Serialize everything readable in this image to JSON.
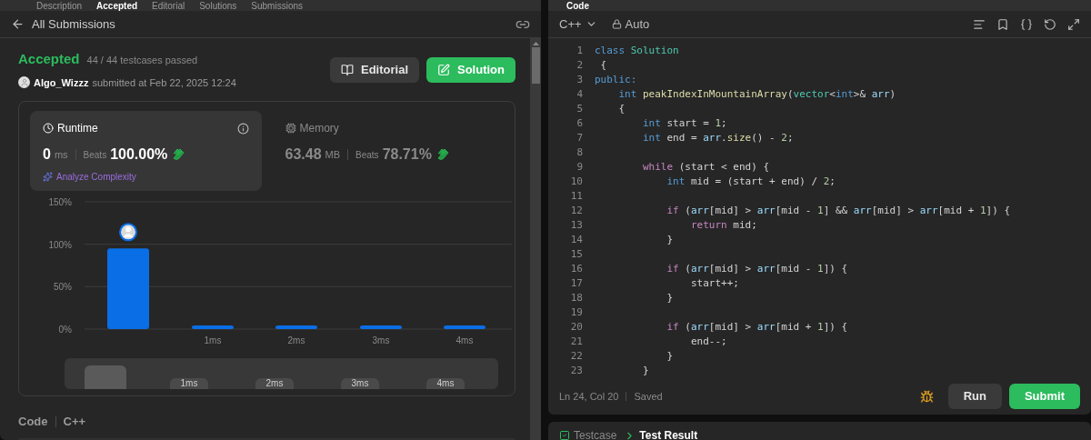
{
  "top_tabs": [
    {
      "label": "Description",
      "selected": false
    },
    {
      "label": "Accepted",
      "selected": true
    },
    {
      "label": "Editorial",
      "selected": false
    },
    {
      "label": "Solutions",
      "selected": false
    },
    {
      "label": "Submissions",
      "selected": false
    }
  ],
  "code_tab": {
    "label": "Code"
  },
  "back_link": "All Submissions",
  "result": {
    "status": "Accepted",
    "testcases": "44 / 44 testcases passed",
    "user": "Algo_Wizzz",
    "submitted": "submitted at Feb 22, 2025 12:24"
  },
  "actions": [
    {
      "label": "Editorial",
      "kind": "secondary"
    },
    {
      "label": "Solution",
      "kind": "primary"
    }
  ],
  "stats": [
    {
      "title": "Runtime",
      "selected": true,
      "value": "0",
      "unit": "ms",
      "beats_label": "Beats",
      "beats": "100.00%"
    },
    {
      "title": "Memory",
      "selected": false,
      "value": "63.48",
      "unit": "MB",
      "beats_label": "Beats",
      "beats": "78.71%"
    }
  ],
  "analyze": "Analyze Complexity",
  "chart_data": {
    "type": "bar",
    "categories": [
      null,
      "1ms",
      "2ms",
      "3ms",
      "4ms"
    ],
    "values": [
      95,
      3,
      3,
      3,
      3
    ],
    "ylim": [
      0,
      150
    ],
    "yticks": [
      {
        "value": 0,
        "label": "0%"
      },
      {
        "value": 50,
        "label": "50%"
      },
      {
        "value": 100,
        "label": "100%"
      },
      {
        "value": 150,
        "label": "150%"
      }
    ]
  },
  "brush_labels": [
    "1ms",
    "2ms",
    "3ms",
    "4ms"
  ],
  "code_section": {
    "title": "Code",
    "language": "C++"
  },
  "editor": {
    "language": "C++",
    "mode": "Auto",
    "status": "Ln 24, Col 20",
    "saved": "Saved",
    "lines": [
      {
        "n": "1",
        "tokens": [
          {
            "kind": "kw",
            "t": "class "
          },
          {
            "kind": "type",
            "t": "Solution"
          }
        ]
      },
      {
        "n": "2",
        "tokens": [
          {
            "kind": "plain",
            "t": " {"
          }
        ]
      },
      {
        "n": "3",
        "tokens": [
          {
            "kind": "kw",
            "t": "public:"
          }
        ]
      },
      {
        "n": "4",
        "tokens": [
          {
            "kind": "kw",
            "t": "    int "
          },
          {
            "kind": "fn",
            "t": "peakIndexInMountainArray"
          },
          {
            "kind": "plain",
            "t": "("
          },
          {
            "kind": "type",
            "t": "vector"
          },
          {
            "kind": "plain",
            "t": "<"
          },
          {
            "kind": "kw",
            "t": "int"
          },
          {
            "kind": "plain",
            "t": ">& "
          },
          {
            "kind": "var",
            "t": "arr"
          },
          {
            "kind": "plain",
            "t": ")"
          }
        ]
      },
      {
        "n": "5",
        "tokens": [
          {
            "kind": "plain",
            "t": "    {"
          }
        ]
      },
      {
        "n": "6",
        "tokens": [
          {
            "kind": "kw",
            "t": "        int "
          },
          {
            "kind": "plain",
            "t": "start = "
          },
          {
            "kind": "num",
            "t": "1"
          },
          {
            "kind": "plain",
            "t": ";"
          }
        ]
      },
      {
        "n": "7",
        "tokens": [
          {
            "kind": "kw",
            "t": "        int "
          },
          {
            "kind": "plain",
            "t": "end = "
          },
          {
            "kind": "var",
            "t": "arr"
          },
          {
            "kind": "plain",
            "t": "."
          },
          {
            "kind": "fn",
            "t": "size"
          },
          {
            "kind": "plain",
            "t": "() - "
          },
          {
            "kind": "num",
            "t": "2"
          },
          {
            "kind": "plain",
            "t": ";"
          }
        ]
      },
      {
        "n": "8"
      },
      {
        "n": "9",
        "tokens": [
          {
            "kind": "ctl",
            "t": "        while"
          },
          {
            "kind": "plain",
            "t": " (start < end) {"
          }
        ]
      },
      {
        "n": "10",
        "tokens": [
          {
            "kind": "kw",
            "t": "            int "
          },
          {
            "kind": "plain",
            "t": "mid = (start + end) / "
          },
          {
            "kind": "num",
            "t": "2"
          },
          {
            "kind": "plain",
            "t": ";"
          }
        ]
      },
      {
        "n": "11"
      },
      {
        "n": "12",
        "tokens": [
          {
            "kind": "ctl",
            "t": "            if"
          },
          {
            "kind": "plain",
            "t": " ("
          },
          {
            "kind": "var",
            "t": "arr"
          },
          {
            "kind": "plain",
            "t": "[mid] > "
          },
          {
            "kind": "var",
            "t": "arr"
          },
          {
            "kind": "plain",
            "t": "[mid - "
          },
          {
            "kind": "num",
            "t": "1"
          },
          {
            "kind": "plain",
            "t": "] && "
          },
          {
            "kind": "var",
            "t": "arr"
          },
          {
            "kind": "plain",
            "t": "[mid] > "
          },
          {
            "kind": "var",
            "t": "arr"
          },
          {
            "kind": "plain",
            "t": "[mid + "
          },
          {
            "kind": "num",
            "t": "1"
          },
          {
            "kind": "plain",
            "t": "]) {"
          }
        ]
      },
      {
        "n": "13",
        "tokens": [
          {
            "kind": "ctl",
            "t": "                return"
          },
          {
            "kind": "plain",
            "t": " mid;"
          }
        ]
      },
      {
        "n": "14",
        "tokens": [
          {
            "kind": "plain",
            "t": "            }"
          }
        ]
      },
      {
        "n": "15"
      },
      {
        "n": "16",
        "tokens": [
          {
            "kind": "ctl",
            "t": "            if"
          },
          {
            "kind": "plain",
            "t": " ("
          },
          {
            "kind": "var",
            "t": "arr"
          },
          {
            "kind": "plain",
            "t": "[mid] > "
          },
          {
            "kind": "var",
            "t": "arr"
          },
          {
            "kind": "plain",
            "t": "[mid - "
          },
          {
            "kind": "num",
            "t": "1"
          },
          {
            "kind": "plain",
            "t": "]) {"
          }
        ]
      },
      {
        "n": "17",
        "tokens": [
          {
            "kind": "plain",
            "t": "                start++;"
          }
        ]
      },
      {
        "n": "18",
        "tokens": [
          {
            "kind": "plain",
            "t": "            }"
          }
        ]
      },
      {
        "n": "19"
      },
      {
        "n": "20",
        "tokens": [
          {
            "kind": "ctl",
            "t": "            if"
          },
          {
            "kind": "plain",
            "t": " ("
          },
          {
            "kind": "var",
            "t": "arr"
          },
          {
            "kind": "plain",
            "t": "[mid] > "
          },
          {
            "kind": "var",
            "t": "arr"
          },
          {
            "kind": "plain",
            "t": "[mid + "
          },
          {
            "kind": "num",
            "t": "1"
          },
          {
            "kind": "plain",
            "t": "]) {"
          }
        ]
      },
      {
        "n": "21",
        "tokens": [
          {
            "kind": "plain",
            "t": "                end--;"
          }
        ]
      },
      {
        "n": "22",
        "tokens": [
          {
            "kind": "plain",
            "t": "            }"
          }
        ]
      },
      {
        "n": "23",
        "tokens": [
          {
            "kind": "plain",
            "t": "        }"
          }
        ]
      }
    ]
  },
  "run_buttons": [
    {
      "label": "Run",
      "kind": "secondary"
    },
    {
      "label": "Submit",
      "kind": "primary"
    }
  ],
  "bottom_tabs": [
    {
      "label": "Testcase",
      "selected": false
    },
    {
      "label": "Test Result",
      "selected": true
    }
  ]
}
